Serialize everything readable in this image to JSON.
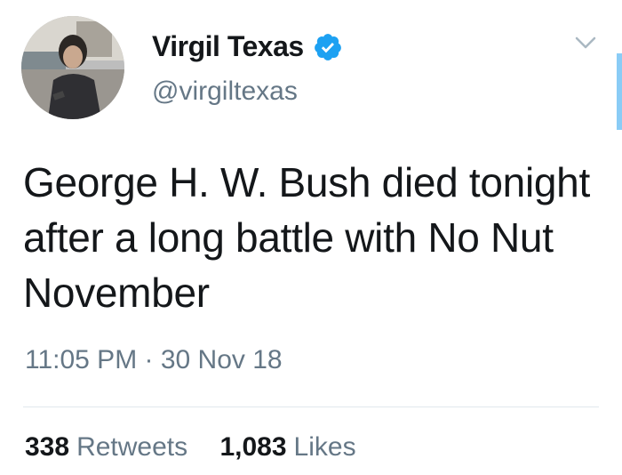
{
  "user": {
    "display_name": "Virgil Texas",
    "handle": "@virgiltexas",
    "verified": true
  },
  "tweet": {
    "text": "George H. W. Bush died tonight after a long battle with No Nut November",
    "timestamp": "11:05 PM · 30 Nov 18"
  },
  "stats": {
    "retweets_count": "338",
    "retweets_label": "Retweets",
    "likes_count": "1,083",
    "likes_label": "Likes"
  },
  "colors": {
    "verified_blue": "#1da1f2",
    "secondary_text": "#657786",
    "primary_text": "#14171a",
    "divider": "#e1e8ed"
  },
  "icons": {
    "verified": "verified-badge-icon",
    "menu": "chevron-down-icon"
  }
}
